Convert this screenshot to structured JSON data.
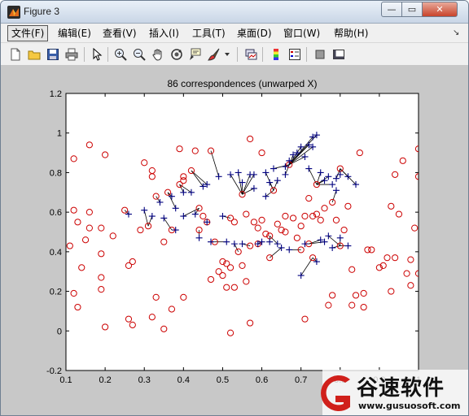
{
  "window": {
    "title": "Figure 3",
    "minimize_glyph": "—",
    "maximize_glyph": "▭",
    "close_glyph": "✕"
  },
  "menu": [
    "文件(F)",
    "编辑(E)",
    "查看(V)",
    "插入(I)",
    "工具(T)",
    "桌面(D)",
    "窗口(W)",
    "帮助(H)"
  ],
  "toolbar_icons": [
    "new-figure-icon",
    "open-file-icon",
    "save-icon",
    "print-icon",
    "pointer-icon",
    "zoom-in-icon",
    "zoom-out-icon",
    "pan-hand-icon",
    "rotate-3d-icon",
    "data-cursor-icon",
    "brush-icon",
    "link-plot-icon",
    "colorbar-icon",
    "legend-icon",
    "hide-plot-tools-icon",
    "show-plot-tools-icon"
  ],
  "colors": {
    "circle": "#cc0000",
    "plus": "#00007f",
    "line": "#000000",
    "figure_bg": "#c8c8c8"
  },
  "watermark": {
    "brand": "谷速软件",
    "url": "www.gusuosoft.com"
  },
  "chart_data": {
    "type": "scatter",
    "title": "86 correspondences (unwarped X)",
    "xlabel": "",
    "ylabel": "",
    "xlim": [
      0.1,
      1.0
    ],
    "ylim": [
      -0.2,
      1.2
    ],
    "xticks": [
      "0.1",
      "0.2",
      "0.3",
      "0.4",
      "0.5",
      "0.6",
      "0.7",
      "0.8",
      "0.9",
      "1"
    ],
    "yticks": [
      "-0.2",
      "0",
      "0.2",
      "0.4",
      "0.6",
      "0.8",
      "1",
      "1.2"
    ],
    "grid": false,
    "circles": [
      [
        0.12,
        0.87
      ],
      [
        0.12,
        0.61
      ],
      [
        0.11,
        0.43
      ],
      [
        0.12,
        0.19
      ],
      [
        0.13,
        0.12
      ],
      [
        0.14,
        0.32
      ],
      [
        0.13,
        0.55
      ],
      [
        0.16,
        0.94
      ],
      [
        0.16,
        0.52
      ],
      [
        0.15,
        0.46
      ],
      [
        0.16,
        0.6
      ],
      [
        0.19,
        0.52
      ],
      [
        0.19,
        0.39
      ],
      [
        0.19,
        0.27
      ],
      [
        0.2,
        0.89
      ],
      [
        0.2,
        0.02
      ],
      [
        0.19,
        0.21
      ],
      [
        0.22,
        0.48
      ],
      [
        0.25,
        0.61
      ],
      [
        0.26,
        0.33
      ],
      [
        0.26,
        0.06
      ],
      [
        0.27,
        0.03
      ],
      [
        0.27,
        0.35
      ],
      [
        0.29,
        0.51
      ],
      [
        0.3,
        0.85
      ],
      [
        0.31,
        0.53
      ],
      [
        0.32,
        0.81
      ],
      [
        0.32,
        0.07
      ],
      [
        0.32,
        0.78
      ],
      [
        0.33,
        0.68
      ],
      [
        0.33,
        0.17
      ],
      [
        0.35,
        0.01
      ],
      [
        0.35,
        0.45
      ],
      [
        0.36,
        0.7
      ],
      [
        0.37,
        0.51
      ],
      [
        0.37,
        0.11
      ],
      [
        0.39,
        0.74
      ],
      [
        0.39,
        0.92
      ],
      [
        0.4,
        0.76
      ],
      [
        0.4,
        0.17
      ],
      [
        0.4,
        0.78
      ],
      [
        0.42,
        0.81
      ],
      [
        0.43,
        0.91
      ],
      [
        0.44,
        0.62
      ],
      [
        0.44,
        0.51
      ],
      [
        0.45,
        0.58
      ],
      [
        0.46,
        0.55
      ],
      [
        0.47,
        0.91
      ],
      [
        0.47,
        0.26
      ],
      [
        0.48,
        0.45
      ],
      [
        0.49,
        0.3
      ],
      [
        0.5,
        0.28
      ],
      [
        0.5,
        0.35
      ],
      [
        0.51,
        0.22
      ],
      [
        0.51,
        0.34
      ],
      [
        0.52,
        0.32
      ],
      [
        0.52,
        -0.01
      ],
      [
        0.52,
        0.57
      ],
      [
        0.53,
        0.55
      ],
      [
        0.53,
        0.22
      ],
      [
        0.54,
        0.4
      ],
      [
        0.55,
        0.33
      ],
      [
        0.55,
        0.69
      ],
      [
        0.56,
        0.59
      ],
      [
        0.56,
        0.25
      ],
      [
        0.57,
        0.97
      ],
      [
        0.57,
        0.43
      ],
      [
        0.57,
        0.04
      ],
      [
        0.58,
        0.55
      ],
      [
        0.59,
        0.44
      ],
      [
        0.59,
        0.52
      ],
      [
        0.6,
        0.9
      ],
      [
        0.6,
        0.56
      ],
      [
        0.61,
        0.49
      ],
      [
        0.62,
        0.37
      ],
      [
        0.62,
        0.48
      ],
      [
        0.63,
        0.71
      ],
      [
        0.64,
        0.54
      ],
      [
        0.65,
        0.51
      ],
      [
        0.66,
        0.5
      ],
      [
        0.66,
        0.58
      ],
      [
        0.67,
        0.84
      ],
      [
        0.68,
        0.57
      ],
      [
        0.69,
        0.47
      ],
      [
        0.7,
        0.53
      ],
      [
        0.7,
        0.41
      ],
      [
        0.71,
        0.06
      ],
      [
        0.71,
        0.58
      ],
      [
        0.72,
        0.44
      ],
      [
        0.72,
        0.67
      ],
      [
        0.73,
        0.58
      ],
      [
        0.73,
        0.37
      ],
      [
        0.74,
        0.74
      ],
      [
        0.74,
        0.59
      ],
      [
        0.75,
        0.56
      ],
      [
        0.76,
        0.62
      ],
      [
        0.77,
        0.13
      ],
      [
        0.78,
        0.65
      ],
      [
        0.78,
        0.18
      ],
      [
        0.79,
        0.56
      ],
      [
        0.8,
        0.43
      ],
      [
        0.8,
        0.82
      ],
      [
        0.81,
        0.51
      ],
      [
        0.82,
        0.63
      ],
      [
        0.83,
        0.31
      ],
      [
        0.83,
        0.13
      ],
      [
        0.84,
        0.18
      ],
      [
        0.85,
        0.9
      ],
      [
        0.86,
        0.19
      ],
      [
        0.86,
        0.12
      ],
      [
        0.87,
        0.41
      ],
      [
        0.88,
        0.41
      ],
      [
        0.9,
        0.32
      ],
      [
        0.91,
        0.33
      ],
      [
        0.92,
        0.37
      ],
      [
        0.93,
        0.2
      ],
      [
        0.93,
        0.63
      ],
      [
        0.94,
        0.37
      ],
      [
        0.94,
        0.79
      ],
      [
        0.95,
        0.59
      ],
      [
        0.96,
        0.86
      ],
      [
        0.97,
        0.29
      ],
      [
        0.98,
        0.36
      ],
      [
        0.98,
        0.23
      ],
      [
        0.99,
        0.52
      ],
      [
        1.0,
        0.92
      ],
      [
        1.0,
        0.78
      ],
      [
        1.0,
        0.29
      ],
      [
        1.01,
        0.45
      ],
      [
        1.02,
        0.48
      ],
      [
        1.03,
        0.44
      ]
    ],
    "pluses": [
      [
        0.26,
        0.59
      ],
      [
        0.3,
        0.61
      ],
      [
        0.32,
        0.58
      ],
      [
        0.34,
        0.65
      ],
      [
        0.35,
        0.57
      ],
      [
        0.37,
        0.68
      ],
      [
        0.38,
        0.62
      ],
      [
        0.38,
        0.51
      ],
      [
        0.4,
        0.7
      ],
      [
        0.4,
        0.58
      ],
      [
        0.42,
        0.7
      ],
      [
        0.43,
        0.59
      ],
      [
        0.44,
        0.47
      ],
      [
        0.45,
        0.73
      ],
      [
        0.46,
        0.74
      ],
      [
        0.46,
        0.55
      ],
      [
        0.47,
        0.45
      ],
      [
        0.49,
        0.78
      ],
      [
        0.5,
        0.58
      ],
      [
        0.51,
        0.45
      ],
      [
        0.52,
        0.79
      ],
      [
        0.53,
        0.44
      ],
      [
        0.54,
        0.8
      ],
      [
        0.55,
        0.75
      ],
      [
        0.55,
        0.44
      ],
      [
        0.57,
        0.79
      ],
      [
        0.58,
        0.79
      ],
      [
        0.58,
        0.72
      ],
      [
        0.59,
        0.44
      ],
      [
        0.6,
        0.45
      ],
      [
        0.61,
        0.8
      ],
      [
        0.61,
        0.68
      ],
      [
        0.62,
        0.75
      ],
      [
        0.62,
        0.45
      ],
      [
        0.63,
        0.82
      ],
      [
        0.64,
        0.76
      ],
      [
        0.64,
        0.44
      ],
      [
        0.65,
        0.42
      ],
      [
        0.66,
        0.83
      ],
      [
        0.66,
        0.79
      ],
      [
        0.67,
        0.86
      ],
      [
        0.67,
        0.41
      ],
      [
        0.68,
        0.89
      ],
      [
        0.69,
        0.9
      ],
      [
        0.7,
        0.93
      ],
      [
        0.7,
        0.28
      ],
      [
        0.71,
        0.88
      ],
      [
        0.71,
        0.44
      ],
      [
        0.72,
        0.94
      ],
      [
        0.72,
        0.82
      ],
      [
        0.73,
        0.98
      ],
      [
        0.73,
        0.93
      ],
      [
        0.74,
        0.99
      ],
      [
        0.74,
        0.35
      ],
      [
        0.75,
        0.8
      ],
      [
        0.75,
        0.46
      ],
      [
        0.76,
        0.76
      ],
      [
        0.76,
        0.45
      ],
      [
        0.77,
        0.78
      ],
      [
        0.77,
        0.48
      ],
      [
        0.78,
        0.74
      ],
      [
        0.78,
        0.42
      ],
      [
        0.79,
        0.77
      ],
      [
        0.79,
        0.71
      ],
      [
        0.8,
        0.79
      ],
      [
        0.8,
        0.47
      ],
      [
        0.82,
        0.78
      ],
      [
        0.82,
        0.43
      ],
      [
        0.84,
        0.74
      ]
    ]
  }
}
